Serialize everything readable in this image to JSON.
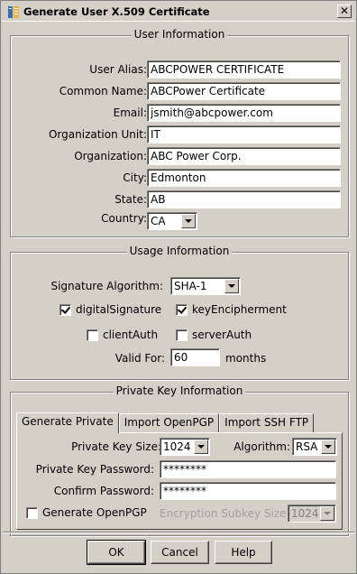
{
  "window": {
    "title": "Generate User X.509 Certificate",
    "close_label": "✕"
  },
  "user_info": {
    "section_title": "User Information",
    "fields": [
      {
        "label": "User Alias:",
        "value": "ABCPOWER CERTIFICATE"
      },
      {
        "label": "Common Name:",
        "value": "ABCPower Certificate"
      },
      {
        "label": "Email:",
        "value": "jsmith@abcpower.com"
      },
      {
        "label": "Organization Unit:",
        "value": "IT"
      },
      {
        "label": "Organization:",
        "value": "ABC Power Corp."
      },
      {
        "label": "City:",
        "value": "Edmonton"
      },
      {
        "label": "State:",
        "value": "AB"
      }
    ],
    "country_label": "Country:",
    "country_value": "CA"
  },
  "usage_info": {
    "section_title": "Usage Information",
    "sig_label": "Signature Algorithm:",
    "sig_value": "SHA-1",
    "digital_signature": {
      "label": "digitalSignature",
      "checked": true
    },
    "key_encipherment": {
      "label": "keyEncipherment",
      "checked": true
    },
    "client_auth": {
      "label": "clientAuth",
      "checked": false
    },
    "server_auth": {
      "label": "serverAuth",
      "checked": false
    },
    "valid_label": "Valid For:",
    "valid_value": "60",
    "valid_unit": "months"
  },
  "key_info": {
    "section_title": "Private Key Information",
    "tabs": [
      "Generate Private",
      "Import OpenPGP",
      "Import SSH FTP"
    ],
    "active_tab": "Generate Private",
    "key_size_label": "Private Key Size:",
    "key_size_value": "1024",
    "algorithm_label": "Algorithm:",
    "algorithm_value": "RSA",
    "password_label": "Private Key Password:",
    "password_value": "********",
    "confirm_label": "Confirm Password:",
    "confirm_value": "********",
    "generate_openpgp": {
      "label": "Generate OpenPGP",
      "checked": false
    },
    "subkey_label": "Encryption Subkey Size:",
    "subkey_value": "1024"
  },
  "buttons": {
    "ok": "OK",
    "cancel": "Cancel",
    "help": "Help"
  }
}
